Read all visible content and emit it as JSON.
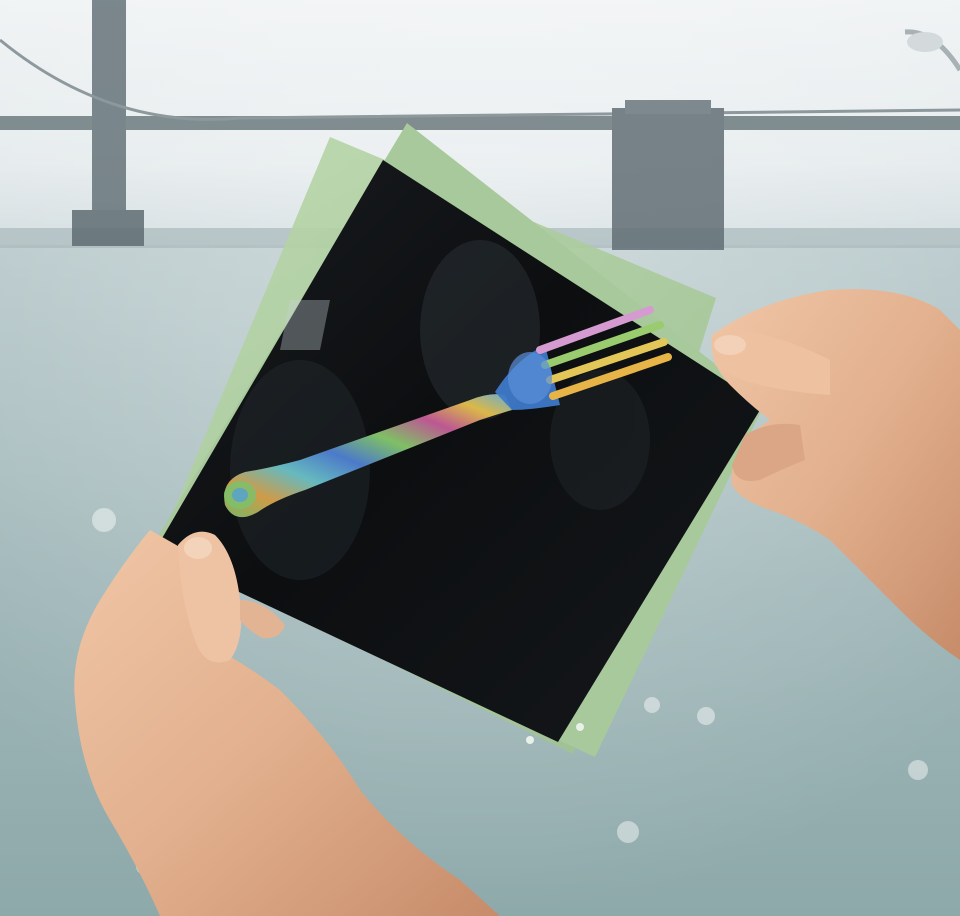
{
  "photo": {
    "subject": "polarized-film-sheets-with-fork",
    "palette": {
      "sky": "#e7ecee",
      "water": "#9fb7b9",
      "bridge": "#5d6a70",
      "film_dark": "#101214",
      "film_edge": "#a7c99b",
      "skin": "#e0b08f"
    }
  }
}
